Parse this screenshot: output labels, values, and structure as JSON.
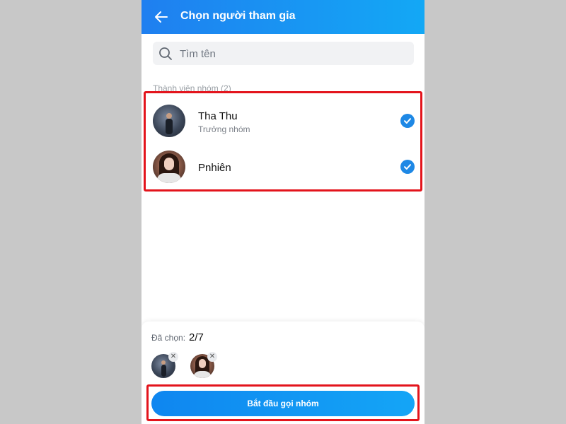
{
  "header": {
    "title": "Chọn người tham gia",
    "back_icon": "arrow-left-icon"
  },
  "search": {
    "placeholder": "Tìm tên",
    "value": "",
    "icon": "search-icon"
  },
  "section": {
    "label": "Thành viên nhóm (2)"
  },
  "members": [
    {
      "name": "Tha Thu",
      "role": "Trưởng nhóm",
      "checked": true
    },
    {
      "name": "Pnhiên",
      "role": "",
      "checked": true
    }
  ],
  "footer": {
    "selected_label": "Đã chọn:",
    "selected_count": "2/7",
    "start_button": "Bắt đầu gọi nhóm"
  },
  "colors": {
    "accent": "#1e88e5",
    "header_start": "#1f7ff0",
    "header_end": "#13a8f5",
    "highlight": "#e3141c"
  }
}
